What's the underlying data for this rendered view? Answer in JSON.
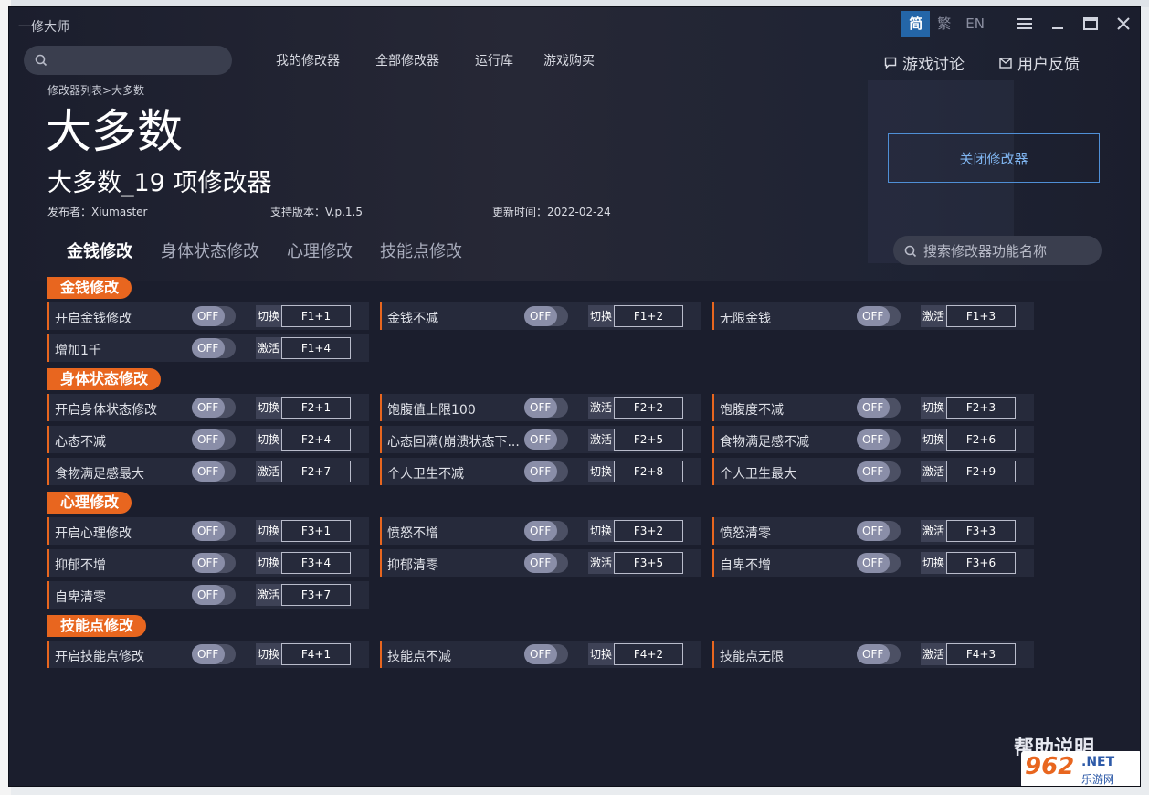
{
  "app_name": "一修大师",
  "lang": [
    "简",
    "繁",
    "EN"
  ],
  "nav": {
    "my": "我的修改器",
    "all": "全部修改器",
    "runtime": "运行库",
    "buy": "游戏购买",
    "discuss": "游戏讨论",
    "feedback": "用户反馈"
  },
  "breadcrumb": "修改器列表>大多数",
  "title": "大多数",
  "subtitle": "大多数_19 项修改器",
  "meta": {
    "publisher": "发布者：Xiumaster",
    "version": "支持版本：V.p.1.5",
    "updated": "更新时间：2022-02-24"
  },
  "close_button": "关闭修改器",
  "tabs": [
    "金钱修改",
    "身体状态修改",
    "心理修改",
    "技能点修改"
  ],
  "search_placeholder": "搜索修改器功能名称",
  "toggle_off": "OFF",
  "sections": [
    {
      "title": "金钱修改",
      "items": [
        {
          "label": "开启金钱修改",
          "mode": "切换",
          "hotkey": "F1+1"
        },
        {
          "label": "金钱不减",
          "mode": "切换",
          "hotkey": "F1+2"
        },
        {
          "label": "无限金钱",
          "mode": "激活",
          "hotkey": "F1+3"
        },
        {
          "label": "增加1千",
          "mode": "激活",
          "hotkey": "F1+4"
        }
      ]
    },
    {
      "title": "身体状态修改",
      "items": [
        {
          "label": "开启身体状态修改",
          "mode": "切换",
          "hotkey": "F2+1"
        },
        {
          "label": "饱腹值上限100",
          "mode": "激活",
          "hotkey": "F2+2"
        },
        {
          "label": "饱腹度不减",
          "mode": "切换",
          "hotkey": "F2+3"
        },
        {
          "label": "心态不减",
          "mode": "切换",
          "hotkey": "F2+4"
        },
        {
          "label": "心态回满(崩溃状态下...",
          "mode": "激活",
          "hotkey": "F2+5"
        },
        {
          "label": "食物满足感不减",
          "mode": "切换",
          "hotkey": "F2+6"
        },
        {
          "label": "食物满足感最大",
          "mode": "激活",
          "hotkey": "F2+7"
        },
        {
          "label": "个人卫生不减",
          "mode": "切换",
          "hotkey": "F2+8"
        },
        {
          "label": "个人卫生最大",
          "mode": "激活",
          "hotkey": "F2+9"
        }
      ]
    },
    {
      "title": "心理修改",
      "items": [
        {
          "label": "开启心理修改",
          "mode": "切换",
          "hotkey": "F3+1"
        },
        {
          "label": "愤怒不增",
          "mode": "切换",
          "hotkey": "F3+2"
        },
        {
          "label": "愤怒清零",
          "mode": "激活",
          "hotkey": "F3+3"
        },
        {
          "label": "抑郁不增",
          "mode": "切换",
          "hotkey": "F3+4"
        },
        {
          "label": "抑郁清零",
          "mode": "激活",
          "hotkey": "F3+5"
        },
        {
          "label": "自卑不增",
          "mode": "切换",
          "hotkey": "F3+6"
        },
        {
          "label": "自卑清零",
          "mode": "激活",
          "hotkey": "F3+7"
        }
      ]
    },
    {
      "title": "技能点修改",
      "items": [
        {
          "label": "开启技能点修改",
          "mode": "切换",
          "hotkey": "F4+1"
        },
        {
          "label": "技能点不减",
          "mode": "切换",
          "hotkey": "F4+2"
        },
        {
          "label": "技能点无限",
          "mode": "激活",
          "hotkey": "F4+3"
        }
      ]
    }
  ],
  "help": "帮助说明",
  "watermark": {
    "num": "962",
    "net": ".NET",
    "cn": "乐游网"
  }
}
